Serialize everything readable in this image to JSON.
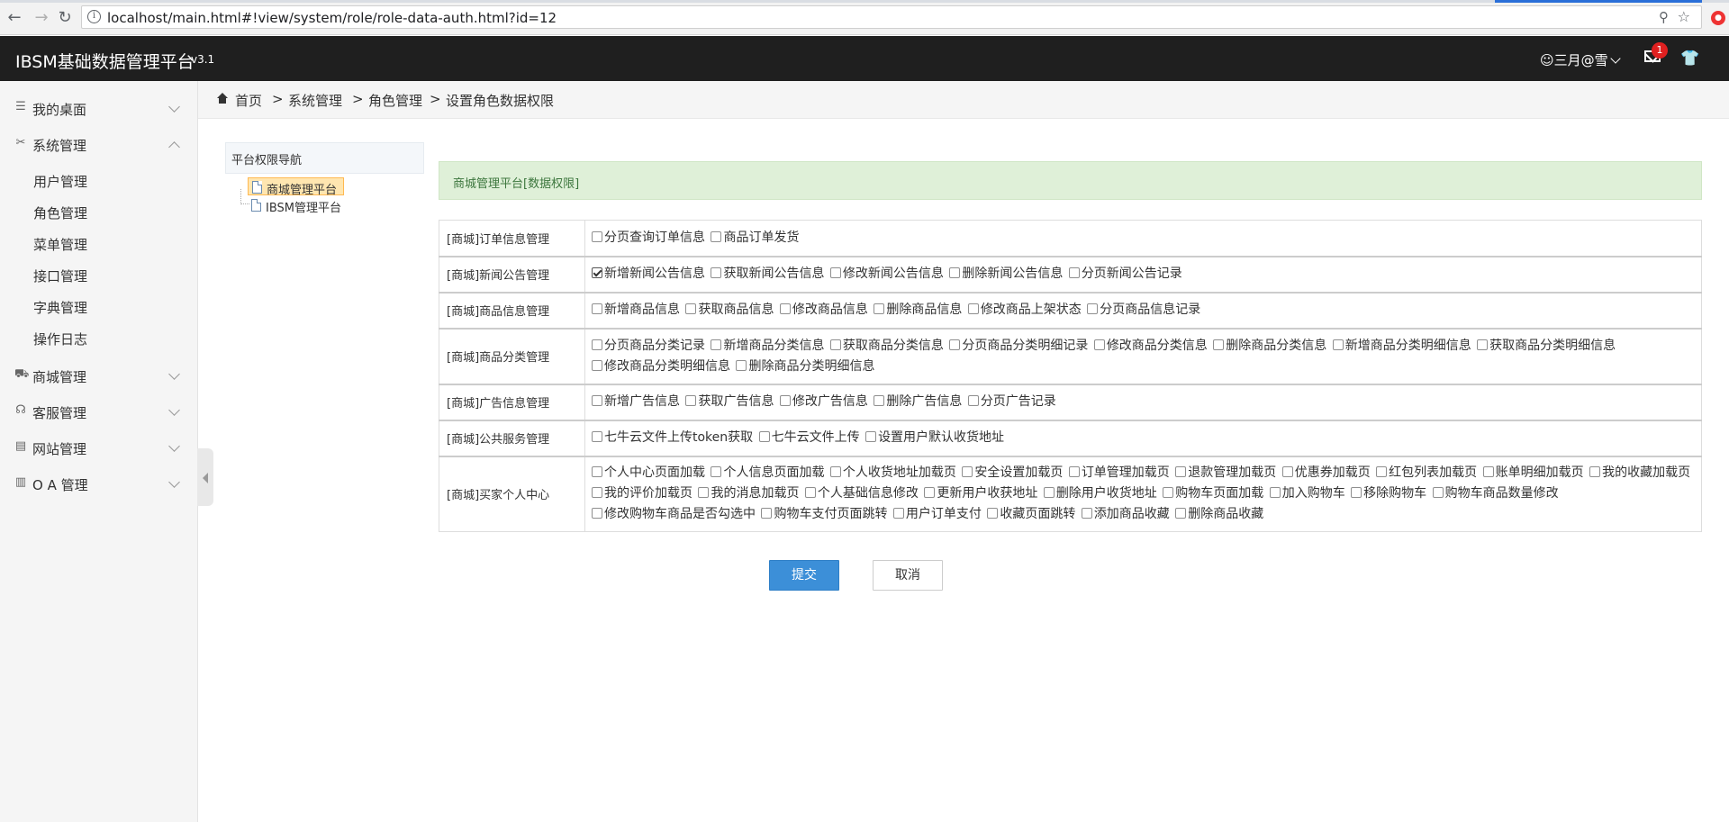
{
  "browser": {
    "url": "localhost/main.html#!view/system/role/role-data-auth.html?id=12",
    "zoom_icon": "magnifier-icon",
    "star_icon": "bookmark-star-icon"
  },
  "header": {
    "title": "IBSM基础数据管理平台",
    "version": "v3.1",
    "user": "三月@雪",
    "mail_badge": "1"
  },
  "sidebar": {
    "items": [
      {
        "label": "我的桌面",
        "icon": "list-icon",
        "expanded": false
      },
      {
        "label": "系统管理",
        "icon": "tools-icon",
        "expanded": true
      },
      {
        "label": "商城管理",
        "icon": "cart-icon",
        "expanded": false
      },
      {
        "label": "客服管理",
        "icon": "headset-icon",
        "expanded": false
      },
      {
        "label": "网站管理",
        "icon": "window-icon",
        "expanded": false
      },
      {
        "label": "O A 管理",
        "icon": "building-icon",
        "expanded": false
      }
    ],
    "sub_items": [
      "用户管理",
      "角色管理",
      "菜单管理",
      "接口管理",
      "字典管理",
      "操作日志"
    ]
  },
  "breadcrumb": {
    "items": [
      "首页",
      "系统管理",
      "角色管理",
      "设置角色数据权限"
    ],
    "separator": ">"
  },
  "tree": {
    "title": "平台权限导航",
    "nodes": [
      "商城管理平台",
      "IBSM管理平台"
    ],
    "selected": 0
  },
  "alert": {
    "text": "商城管理平台[数据权限]"
  },
  "permissions": [
    {
      "category": "[商城]订单信息管理",
      "options": [
        {
          "label": "分页查询订单信息",
          "checked": false
        },
        {
          "label": "商品订单发货",
          "checked": false
        }
      ]
    },
    {
      "category": "[商城]新闻公告管理",
      "options": [
        {
          "label": "新增新闻公告信息",
          "checked": true
        },
        {
          "label": "获取新闻公告信息",
          "checked": false
        },
        {
          "label": "修改新闻公告信息",
          "checked": false
        },
        {
          "label": "删除新闻公告信息",
          "checked": false
        },
        {
          "label": "分页新闻公告记录",
          "checked": false
        }
      ]
    },
    {
      "category": "[商城]商品信息管理",
      "options": [
        {
          "label": "新增商品信息",
          "checked": false
        },
        {
          "label": "获取商品信息",
          "checked": false
        },
        {
          "label": "修改商品信息",
          "checked": false
        },
        {
          "label": "删除商品信息",
          "checked": false
        },
        {
          "label": "修改商品上架状态",
          "checked": false
        },
        {
          "label": "分页商品信息记录",
          "checked": false
        }
      ]
    },
    {
      "category": "[商城]商品分类管理",
      "options": [
        {
          "label": "分页商品分类记录",
          "checked": false
        },
        {
          "label": "新增商品分类信息",
          "checked": false
        },
        {
          "label": "获取商品分类信息",
          "checked": false
        },
        {
          "label": "分页商品分类明细记录",
          "checked": false
        },
        {
          "label": "修改商品分类信息",
          "checked": false
        },
        {
          "label": "删除商品分类信息",
          "checked": false
        },
        {
          "label": "新增商品分类明细信息",
          "checked": false
        },
        {
          "label": "获取商品分类明细信息",
          "checked": false
        },
        {
          "label": "修改商品分类明细信息",
          "checked": false
        },
        {
          "label": "删除商品分类明细信息",
          "checked": false
        }
      ]
    },
    {
      "category": "[商城]广告信息管理",
      "options": [
        {
          "label": "新增广告信息",
          "checked": false
        },
        {
          "label": "获取广告信息",
          "checked": false
        },
        {
          "label": "修改广告信息",
          "checked": false
        },
        {
          "label": "删除广告信息",
          "checked": false
        },
        {
          "label": "分页广告记录",
          "checked": false
        }
      ]
    },
    {
      "category": "[商城]公共服务管理",
      "options": [
        {
          "label": "七牛云文件上传token获取",
          "checked": false
        },
        {
          "label": "七牛云文件上传",
          "checked": false
        },
        {
          "label": "设置用户默认收货地址",
          "checked": false
        }
      ]
    },
    {
      "category": "[商城]买家个人中心",
      "options": [
        {
          "label": "个人中心页面加载",
          "checked": false
        },
        {
          "label": "个人信息页面加载",
          "checked": false
        },
        {
          "label": "个人收货地址加载页",
          "checked": false
        },
        {
          "label": "安全设置加载页",
          "checked": false
        },
        {
          "label": "订单管理加载页",
          "checked": false
        },
        {
          "label": "退款管理加载页",
          "checked": false
        },
        {
          "label": "优惠券加载页",
          "checked": false
        },
        {
          "label": "红包列表加载页",
          "checked": false
        },
        {
          "label": "账单明细加载页",
          "checked": false
        },
        {
          "label": "我的收藏加载页",
          "checked": false
        },
        {
          "label": "我的评价加载页",
          "checked": false
        },
        {
          "label": "我的消息加载页",
          "checked": false
        },
        {
          "label": "个人基础信息修改",
          "checked": false
        },
        {
          "label": "更新用户收获地址",
          "checked": false
        },
        {
          "label": "删除用户收货地址",
          "checked": false
        },
        {
          "label": "购物车页面加载",
          "checked": false
        },
        {
          "label": "加入购物车",
          "checked": false
        },
        {
          "label": "移除购物车",
          "checked": false
        },
        {
          "label": "购物车商品数量修改",
          "checked": false
        },
        {
          "label": "修改购物车商品是否勾选中",
          "checked": false
        },
        {
          "label": "购物车支付页面跳转",
          "checked": false
        },
        {
          "label": "用户订单支付",
          "checked": false
        },
        {
          "label": "收藏页面跳转",
          "checked": false
        },
        {
          "label": "添加商品收藏",
          "checked": false
        },
        {
          "label": "删除商品收藏",
          "checked": false
        }
      ]
    }
  ],
  "buttons": {
    "submit": "提交",
    "cancel": "取消"
  }
}
